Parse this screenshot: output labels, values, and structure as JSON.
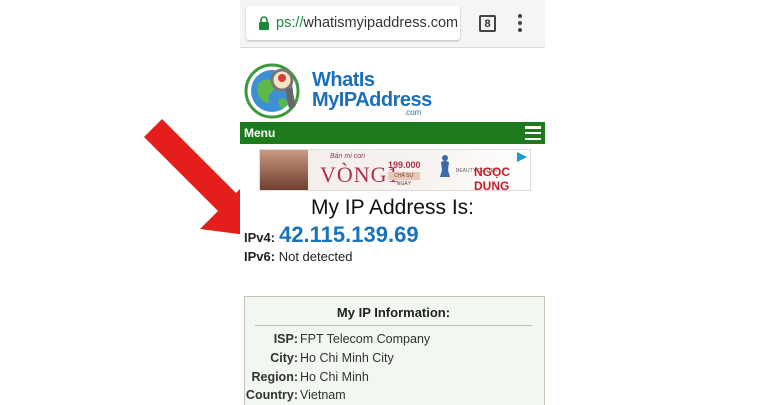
{
  "browser": {
    "url_scheme": "ps://",
    "url_host": "whatismyipaddress.com",
    "tab_count": "8"
  },
  "logo": {
    "line1": "WhatIs",
    "line2": "MyIPAddress",
    "suffix": ".com"
  },
  "menu": {
    "label": "Menu"
  },
  "ad": {
    "small_text": "Bán mi con",
    "headline": "VÒNG1",
    "price": "199.000",
    "badge": "CHẤ SỰ NGÀY",
    "brand_small": "BEAUTY CENTER",
    "brand": "NGỌC DUNG"
  },
  "main": {
    "title": "My IP Address Is:",
    "ipv4_label": "IPv4:",
    "ipv4_value": "42.115.139.69",
    "ipv6_label": "IPv6:",
    "ipv6_value": "Not detected"
  },
  "info": {
    "title": "My IP Information:",
    "rows": [
      {
        "key": "ISP:",
        "value": "FPT Telecom Company"
      },
      {
        "key": "City:",
        "value": "Ho Chi Minh City"
      },
      {
        "key": "Region:",
        "value": "Ho Chi Minh"
      },
      {
        "key": "Country:",
        "value": "Vietnam"
      }
    ]
  },
  "colors": {
    "menu_green": "#1d7a1d",
    "ip_blue": "#1a73b8",
    "arrow_red": "#e41d1d"
  }
}
